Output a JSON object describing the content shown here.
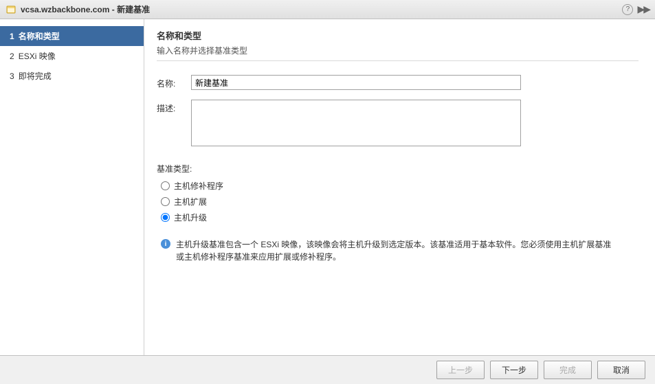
{
  "titlebar": {
    "host": "vcsa.wzbackbone.com",
    "sep": " - ",
    "title": "新建基准"
  },
  "sidebar": {
    "steps": [
      {
        "num": "1",
        "label": "名称和类型"
      },
      {
        "num": "2",
        "label": "ESXi 映像"
      },
      {
        "num": "3",
        "label": "即将完成"
      }
    ]
  },
  "content": {
    "heading": "名称和类型",
    "subheading": "输入名称并选择基准类型",
    "nameLabel": "名称:",
    "nameValue": "新建基准",
    "descLabel": "描述:",
    "descValue": "",
    "typeLabel": "基准类型:",
    "radios": [
      {
        "label": "主机修补程序"
      },
      {
        "label": "主机扩展"
      },
      {
        "label": "主机升级"
      }
    ],
    "infoText": "主机升级基准包含一个 ESXi 映像，该映像会将主机升级到选定版本。该基准适用于基本软件。您必须使用主机扩展基准或主机修补程序基准来应用扩展或修补程序。"
  },
  "footer": {
    "back": "上一步",
    "next": "下一步",
    "finish": "完成",
    "cancel": "取消"
  }
}
